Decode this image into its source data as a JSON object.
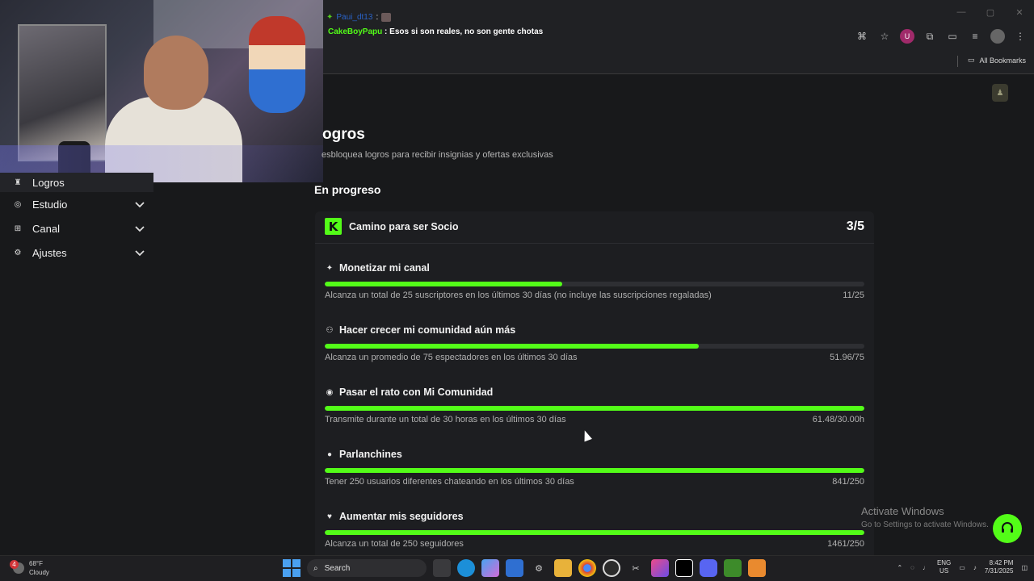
{
  "browser": {
    "bookmarks_label": "All Bookmarks",
    "window_controls": [
      "minimize-icon",
      "maximize-icon",
      "close-icon"
    ],
    "toolbar_icons": [
      "translate-icon",
      "star-icon",
      "profile-badge-icon",
      "extensions-icon",
      "cast-icon",
      "media-icon",
      "account-icon",
      "menu-icon"
    ]
  },
  "chat": {
    "line1_user": "Paui_dt13",
    "line1_sep": ":",
    "line2_user": "CakeBoyPapu",
    "line2_sep": ":",
    "line2_msg": "Esos si son reales, no son gente chotas"
  },
  "sidebar": {
    "items": [
      {
        "label": "Logros",
        "icon": "trophy-icon"
      },
      {
        "label": "Estudio",
        "icon": "studio-icon"
      },
      {
        "label": "Canal",
        "icon": "channel-icon"
      },
      {
        "label": "Ajustes",
        "icon": "gear-icon"
      }
    ]
  },
  "main": {
    "title": "ogros",
    "subtitle": "esbloquea logros para recibir insignias y ofertas exclusivas",
    "section": "En progreso"
  },
  "card": {
    "logo_letter": "K",
    "title": "Camino para ser Socio",
    "count": "3/5",
    "goals": [
      {
        "title": "Monetizar mi canal",
        "icon": "sparkle-icon",
        "desc": "Alcanza un total de 25 suscriptores en los últimos 30 días (no incluye las suscripciones regaladas)",
        "value": "11/25",
        "progress": 0.44
      },
      {
        "title": "Hacer crecer mi comunidad aún más",
        "icon": "users-icon",
        "desc": "Alcanza un promedio de 75 espectadores en los últimos 30 días",
        "value": "51.96/75",
        "progress": 0.693
      },
      {
        "title": "Pasar el rato con Mi Comunidad",
        "icon": "broadcast-icon",
        "desc": "Transmite durante un total de 30 horas en los últimos 30 días",
        "value": "61.48/30.00h",
        "progress": 1.0
      },
      {
        "title": "Parlanchines",
        "icon": "chat-icon",
        "desc": "Tener 250 usuarios diferentes chateando en los últimos 30 días",
        "value": "841/250",
        "progress": 1.0
      },
      {
        "title": "Aumentar mis seguidores",
        "icon": "heart-icon",
        "desc": "Alcanza un total de 250 seguidores",
        "value": "1461/250",
        "progress": 1.0
      }
    ]
  },
  "watermark": {
    "line1": "Activate Windows",
    "line2": "Go to Settings to activate Windows."
  },
  "colors": {
    "accent": "#53fc18",
    "track": "#2e2f33",
    "background": "#18191b",
    "card": "#1d1e21"
  },
  "taskbar": {
    "temp": "68°F",
    "condition": "Cloudy",
    "weather_badge": "4",
    "search_label": "Search",
    "lang_top": "ENG",
    "lang_bottom": "US",
    "time": "8:42 PM",
    "date": "7/31/2025"
  }
}
